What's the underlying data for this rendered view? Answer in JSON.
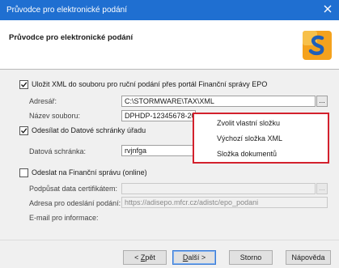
{
  "window": {
    "title": "Průvodce pro elektronické podání"
  },
  "header": {
    "title": "Průvodce pro elektronické podání",
    "logo_icon": "stormware-logo"
  },
  "epo_section": {
    "checkbox_label": "Uložit XML do souboru pro ruční podání přes portál Finanční správy EPO",
    "checked": true,
    "directory_label": "Adresář:",
    "directory_value": "C:\\STORMWARE\\TAX\\XML",
    "filename_label": "Název souboru:",
    "filename_value": "DPHDP-12345678-20",
    "browse_label": "..."
  },
  "ds_section": {
    "checkbox_label": "Odesílat do Datové schránky úřadu",
    "checked": true,
    "mailbox_label": "Datová schránka:",
    "mailbox_value": "rvjnfga"
  },
  "fs_section": {
    "checkbox_label": "Odeslat na Finanční správu (online)",
    "checked": false,
    "cert_label": "Podpůsat data certifikátem:",
    "address_label": "Adresa pro odeslání podání:",
    "address_value": "https://adisepo.mfcr.cz/adistc/epo_podani",
    "email_label": "E-mail pro informace:",
    "browse_label": "..."
  },
  "popup_menu": {
    "items": [
      "Zvolit vlastní složku",
      "Výchozí složka XML",
      "Složka dokumentů"
    ]
  },
  "footer": {
    "back_prefix": "< ",
    "back_key": "Z",
    "back_rest": "pět",
    "next_key": "D",
    "next_rest": "alší >",
    "cancel": "Storno",
    "help": "Nápověda"
  },
  "colors": {
    "titlebar": "#1f6fd1",
    "popup_border": "#d3212d",
    "dialog_bg": "#f0f0f0"
  }
}
